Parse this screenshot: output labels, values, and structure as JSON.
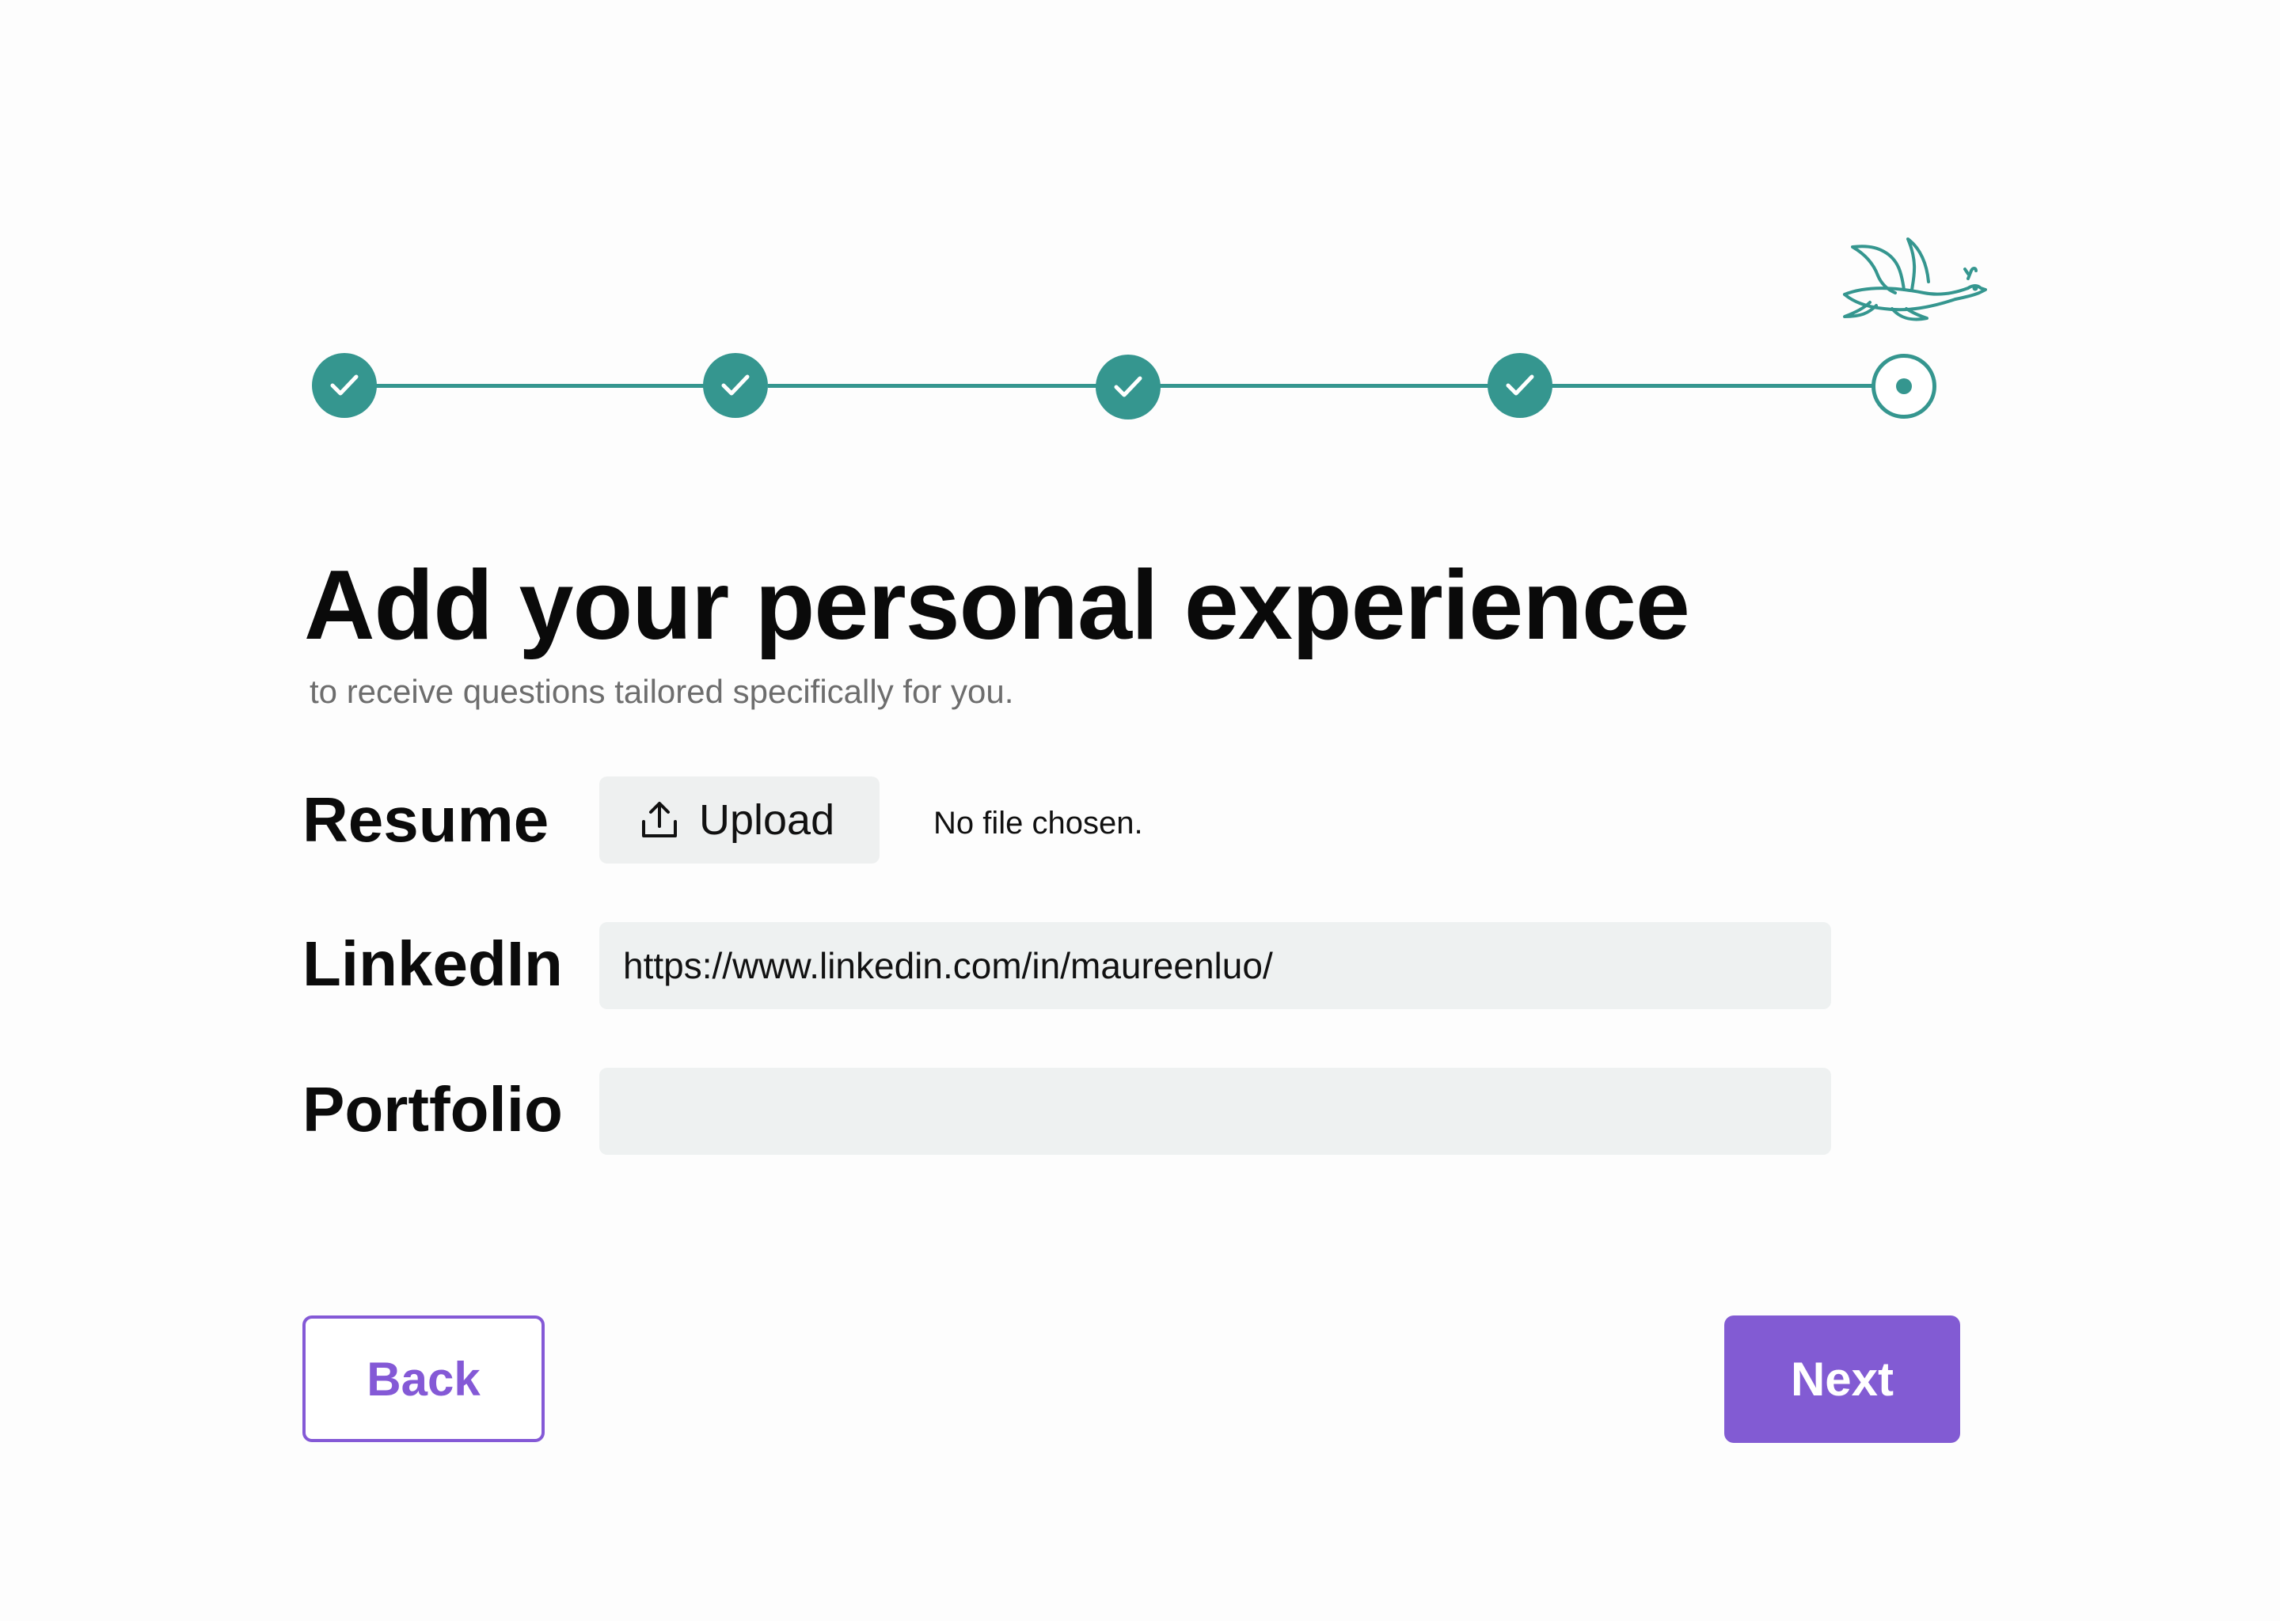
{
  "progress": {
    "total_steps": 5,
    "completed_steps": 4,
    "current_step": 5,
    "accent_color": "#35968f"
  },
  "page": {
    "title": "Add your personal experience",
    "subtitle": "to receive questions tailored specifically for you."
  },
  "form": {
    "resume": {
      "label": "Resume",
      "upload_label": "Upload",
      "upload_icon": "upload-icon",
      "file_status": "No file chosen."
    },
    "linkedin": {
      "label": "LinkedIn",
      "value": "https://www.linkedin.com/in/maureenluo/"
    },
    "portfolio": {
      "label": "Portfolio",
      "value": ""
    }
  },
  "actions": {
    "back_label": "Back",
    "next_label": "Next",
    "primary_color": "#825bd3"
  }
}
